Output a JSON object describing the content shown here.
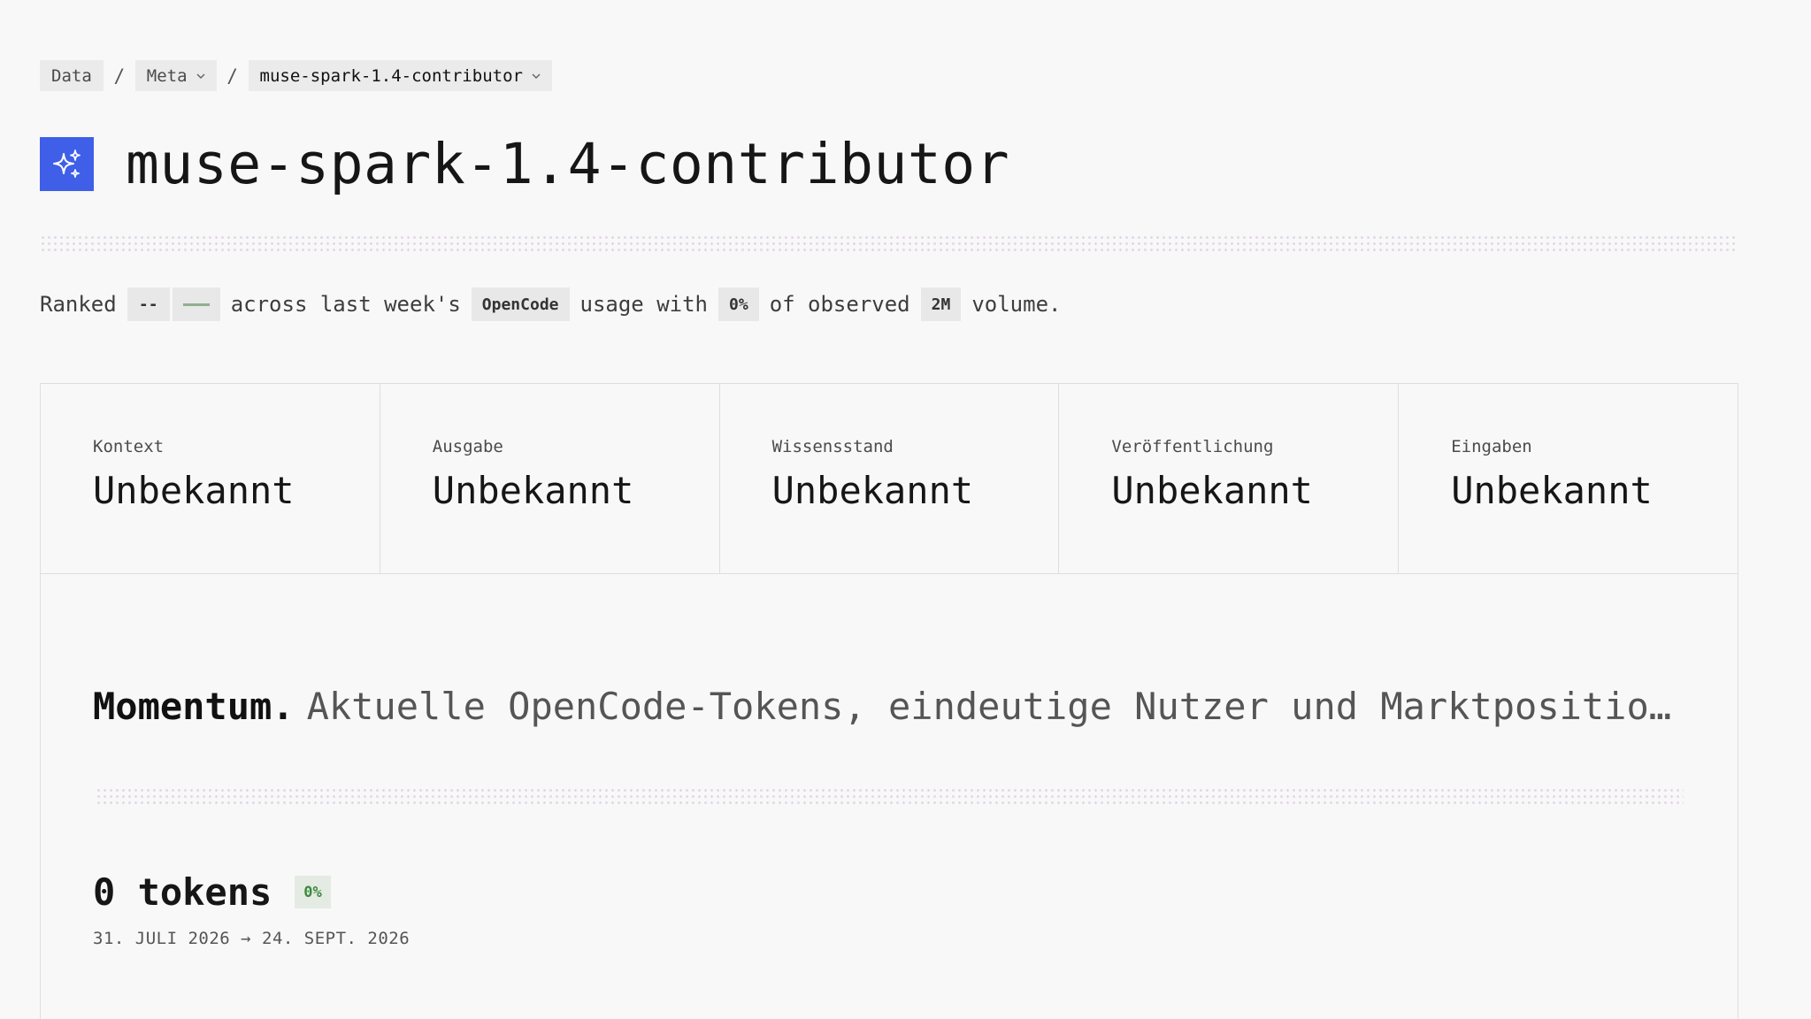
{
  "breadcrumb": {
    "items": [
      {
        "label": "Data",
        "has_dropdown": false
      },
      {
        "label": "Meta",
        "has_dropdown": true
      },
      {
        "label": "muse-spark-1.4-contributor",
        "has_dropdown": true
      }
    ],
    "separator": "/"
  },
  "header": {
    "icon": "sparkles-icon",
    "icon_color": "#3f5fe8",
    "title": "muse-spark-1.4-contributor"
  },
  "summary": {
    "ranked_label": "Ranked",
    "rank_value": "--",
    "text_across": "across last week's",
    "platform": "OpenCode",
    "text_usage": "usage with",
    "share": "0%",
    "text_of": "of observed",
    "volume": "2M",
    "text_end": "volume."
  },
  "specs": [
    {
      "label": "Kontext",
      "value": "Unbekannt"
    },
    {
      "label": "Ausgabe",
      "value": "Unbekannt"
    },
    {
      "label": "Wissensstand",
      "value": "Unbekannt"
    },
    {
      "label": "Veröffentlichung",
      "value": "Unbekannt"
    },
    {
      "label": "Eingaben",
      "value": "Unbekannt"
    }
  ],
  "momentum": {
    "heading": "Momentum.",
    "description": "Aktuelle OpenCode-Tokens, eindeutige Nutzer und Marktpositio…"
  },
  "tokens": {
    "value": "0 tokens",
    "change": "0%",
    "change_color": "#3b8a3e",
    "date_range": "31. JULI 2026 → 24. SEPT. 2026"
  }
}
